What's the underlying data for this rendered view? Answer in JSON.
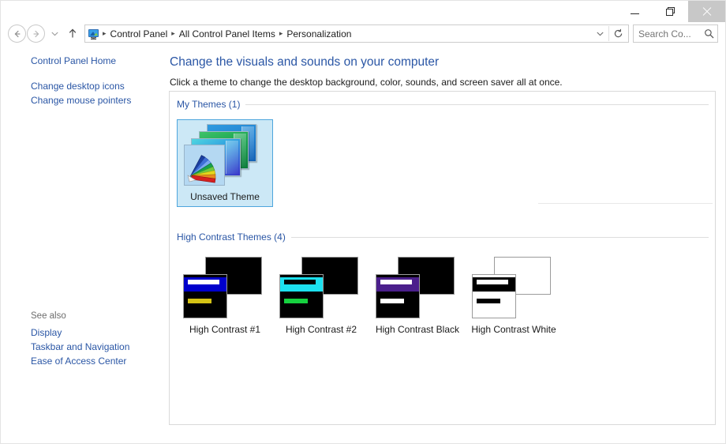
{
  "window": {
    "controls": {
      "minimize_label": "Minimize",
      "maximize_label": "Restore",
      "close_label": "Close"
    }
  },
  "addressbar": {
    "back_label": "Back",
    "forward_label": "Forward",
    "recent_label": "Recent locations",
    "up_label": "Up one level",
    "icon": "control-panel-icon",
    "breadcrumbs": [
      "Control Panel",
      "All Control Panel Items",
      "Personalization"
    ],
    "separator": "▸",
    "dropdown_label": "Previous locations",
    "refresh_label": "Refresh",
    "search": {
      "placeholder": "Search Co...",
      "value": "",
      "icon": "search-icon"
    }
  },
  "sidebar": {
    "links": [
      "Control Panel Home",
      "Change desktop icons",
      "Change mouse pointers"
    ],
    "see_also": {
      "title": "See also",
      "links": [
        "Display",
        "Taskbar and Navigation",
        "Ease of Access Center"
      ]
    }
  },
  "content": {
    "title": "Change the visuals and sounds on your computer",
    "subtitle": "Click a theme to change the desktop background, color, sounds, and screen saver all at once.",
    "groups": [
      {
        "label": "My Themes (1)",
        "themes": [
          {
            "name": "Unsaved Theme",
            "selected": true,
            "kind": "unsaved"
          }
        ]
      },
      {
        "label": "High Contrast Themes (4)",
        "themes": [
          {
            "name": "High Contrast #1",
            "selected": false,
            "kind": "high-contrast",
            "back_color": "#000000",
            "front_color": "#000000",
            "title_color": "#0000cc",
            "inner_bar_color": "#ffffff",
            "low_bar_color": "#d4c215"
          },
          {
            "name": "High Contrast #2",
            "selected": false,
            "kind": "high-contrast",
            "back_color": "#000000",
            "front_color": "#000000",
            "title_color": "#1ce0ef",
            "inner_bar_color": "#000000",
            "low_bar_color": "#16d13f"
          },
          {
            "name": "High Contrast Black",
            "selected": false,
            "kind": "high-contrast",
            "back_color": "#000000",
            "front_color": "#000000",
            "title_color": "#4b1f8c",
            "inner_bar_color": "#ffffff",
            "low_bar_color": "#ffffff"
          },
          {
            "name": "High Contrast White",
            "selected": false,
            "kind": "high-contrast",
            "back_color": "#ffffff",
            "front_color": "#ffffff",
            "title_color": "#000000",
            "inner_bar_color": "#ffffff",
            "low_bar_color": "#000000"
          }
        ]
      }
    ]
  },
  "colors": {
    "link": "#2a56a5",
    "selection_fill": "#cce8f6",
    "selection_border": "#4ea6dd",
    "panel_border": "#d9d9d9"
  }
}
